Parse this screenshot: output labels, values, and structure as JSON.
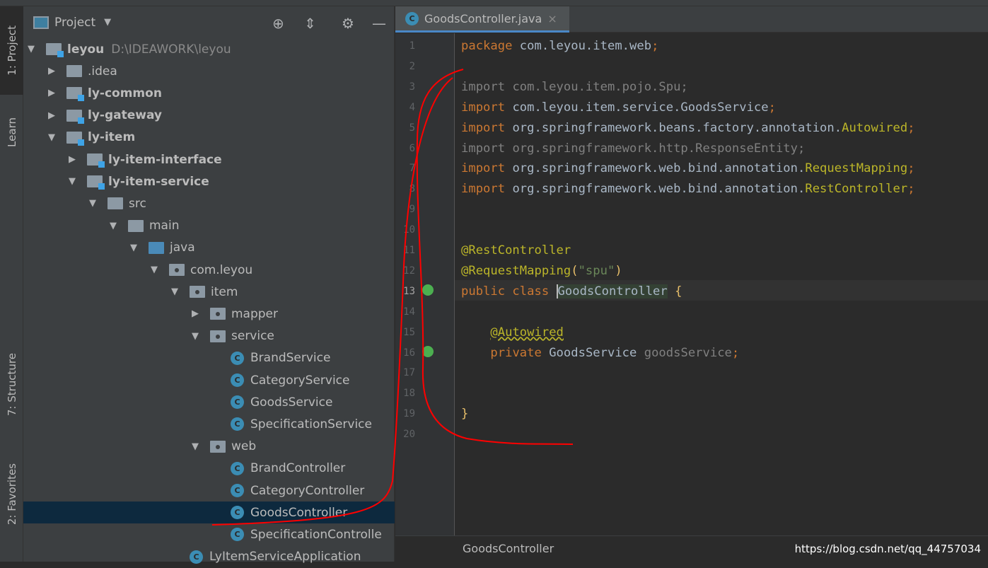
{
  "sidebar_tabs": [
    {
      "label": "1: Project"
    },
    {
      "label": "Learn"
    },
    {
      "label": "7: Structure"
    },
    {
      "label": "2: Favorites"
    }
  ],
  "project_panel": {
    "title": "Project",
    "icons": [
      "locate-icon",
      "collapse-all-icon",
      "gear-icon",
      "minimize-icon"
    ],
    "tree": [
      {
        "label": "leyou",
        "path": "D:\\IDEAWORK\\leyou",
        "level": 0,
        "arrow": "down",
        "icon": "module",
        "bold": true
      },
      {
        "label": ".idea",
        "level": 1,
        "arrow": "right",
        "icon": "folder"
      },
      {
        "label": "ly-common",
        "level": 1,
        "arrow": "right",
        "icon": "module",
        "bold": true
      },
      {
        "label": "ly-gateway",
        "level": 1,
        "arrow": "right",
        "icon": "module",
        "bold": true
      },
      {
        "label": "ly-item",
        "level": 1,
        "arrow": "down",
        "icon": "module",
        "bold": true
      },
      {
        "label": "ly-item-interface",
        "level": 2,
        "arrow": "right",
        "icon": "module",
        "bold": true
      },
      {
        "label": "ly-item-service",
        "level": 2,
        "arrow": "down",
        "icon": "module",
        "bold": true
      },
      {
        "label": "src",
        "level": 3,
        "arrow": "down",
        "icon": "folder"
      },
      {
        "label": "main",
        "level": 4,
        "arrow": "down",
        "icon": "folder"
      },
      {
        "label": "java",
        "level": 5,
        "arrow": "down",
        "icon": "src"
      },
      {
        "label": "com.leyou",
        "level": 6,
        "arrow": "down",
        "icon": "pkg"
      },
      {
        "label": "item",
        "level": 7,
        "arrow": "down",
        "icon": "pkg"
      },
      {
        "label": "mapper",
        "level": 8,
        "arrow": "right",
        "icon": "pkg"
      },
      {
        "label": "service",
        "level": 8,
        "arrow": "down",
        "icon": "pkg"
      },
      {
        "label": "BrandService",
        "level": 9,
        "icon": "class"
      },
      {
        "label": "CategoryService",
        "level": 9,
        "icon": "class"
      },
      {
        "label": "GoodsService",
        "level": 9,
        "icon": "class"
      },
      {
        "label": "SpecificationService",
        "level": 9,
        "icon": "class"
      },
      {
        "label": "web",
        "level": 8,
        "arrow": "down",
        "icon": "pkg"
      },
      {
        "label": "BrandController",
        "level": 9,
        "icon": "class"
      },
      {
        "label": "CategoryController",
        "level": 9,
        "icon": "class"
      },
      {
        "label": "GoodsController",
        "level": 9,
        "icon": "class",
        "selected": true
      },
      {
        "label": "SpecificationControlle",
        "level": 9,
        "icon": "class"
      },
      {
        "label": "LyItemServiceApplication",
        "level": 7,
        "icon": "class"
      }
    ]
  },
  "editor": {
    "tab": {
      "label": "GoodsController.java",
      "close": "×"
    },
    "lines": [
      [
        [
          "package ",
          "kw"
        ],
        [
          "com.leyou.item.web",
          "pk"
        ],
        [
          ";",
          "kw"
        ]
      ],
      [],
      [
        [
          "import ",
          "un"
        ],
        [
          "com.leyou.item.pojo.Spu;",
          "un"
        ]
      ],
      [
        [
          "import ",
          "kw"
        ],
        [
          "com.leyou.item.service.GoodsService",
          "pk"
        ],
        [
          ";",
          "kw"
        ]
      ],
      [
        [
          "import ",
          "kw"
        ],
        [
          "org.springframework.beans.factory.annotation.",
          "pk"
        ],
        [
          "Autowired",
          "an"
        ],
        [
          ";",
          "kw"
        ]
      ],
      [
        [
          "import ",
          "un"
        ],
        [
          "org.springframework.http.ResponseEntity;",
          "un"
        ]
      ],
      [
        [
          "import ",
          "kw"
        ],
        [
          "org.springframework.web.bind.annotation.",
          "pk"
        ],
        [
          "RequestMapping",
          "an"
        ],
        [
          ";",
          "kw"
        ]
      ],
      [
        [
          "import ",
          "kw"
        ],
        [
          "org.springframework.web.bind.annotation.",
          "pk"
        ],
        [
          "RestController",
          "an"
        ],
        [
          ";",
          "kw"
        ]
      ],
      [],
      [],
      [
        [
          "@RestController",
          "an"
        ]
      ],
      [
        [
          "@RequestMapping",
          "an"
        ],
        [
          "(",
          "br"
        ],
        [
          "\"spu\"",
          "st"
        ],
        [
          ")",
          "br"
        ]
      ],
      [
        [
          "public class ",
          "kw"
        ],
        [
          "GoodsController",
          "pl"
        ],
        [
          " {",
          "br"
        ]
      ],
      [],
      [
        [
          "    ",
          "pl"
        ],
        [
          "@Autowired",
          "an"
        ]
      ],
      [
        [
          "    ",
          "pl"
        ],
        [
          "private ",
          "kw"
        ],
        [
          "GoodsService ",
          "pl"
        ],
        [
          "goodsService",
          "gr"
        ],
        [
          ";",
          "kw"
        ]
      ],
      [],
      [],
      [
        [
          "}",
          "br"
        ]
      ],
      []
    ]
  },
  "status": {
    "breadcrumb": "GoodsController",
    "watermark": "https://blog.csdn.net/qq_44757034"
  },
  "colors": {
    "annotation": "#ff0000",
    "selection": "#0d293e",
    "accent": "#4a88c7"
  }
}
